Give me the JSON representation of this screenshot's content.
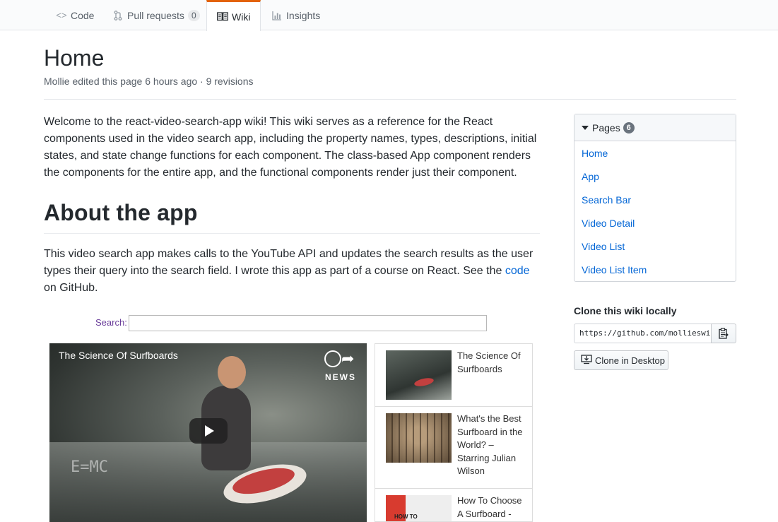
{
  "tabs": [
    {
      "label": "Code",
      "icon": "code-icon"
    },
    {
      "label": "Pull requests",
      "icon": "pull-request-icon",
      "count": "0"
    },
    {
      "label": "Wiki",
      "icon": "book-icon",
      "selected": true
    },
    {
      "label": "Insights",
      "icon": "graph-icon"
    }
  ],
  "page": {
    "title": "Home",
    "meta": "Mollie edited this page 6 hours ago · 9 revisions"
  },
  "content": {
    "intro": "Welcome to the react-video-search-app wiki! This wiki serves as a reference for the React components used in the video search app, including the property names, types, descriptions, initial states, and state change functions for each component. The class-based App component renders the components for the entire app, and the functional components render just their component.",
    "about_heading": "About the app",
    "about_text_before": "This video search app makes calls to the YouTube API and updates the search results as the user types their query into the search field. I wrote this app as part of a course on React. See the ",
    "about_link": "code",
    "about_text_after": " on GitHub."
  },
  "app_screenshot": {
    "search_label": "Search:",
    "player_title": "The Science Of Surfboards",
    "player_badge": "NEWS",
    "player_equation": "E=MC",
    "videos": [
      {
        "title": "The Science Of Surfboards"
      },
      {
        "title": "What's the Best Surfboard in the World? – Starring Julian Wilson"
      },
      {
        "title": "How To Choose A Surfboard -"
      }
    ],
    "thumb3_text": "HOW TO"
  },
  "sidebar": {
    "pages_label": "Pages",
    "pages_count": "6",
    "pages": [
      "Home",
      "App",
      "Search Bar",
      "Video Detail",
      "Video List",
      "Video List Item"
    ],
    "clone_heading": "Clone this wiki locally",
    "clone_url": "https://github.com/mollieswi",
    "clone_desktop_label": "Clone in Desktop"
  },
  "colors": {
    "link": "#0366d6",
    "tab_accent": "#e36209",
    "text": "#24292e",
    "muted": "#586069"
  }
}
